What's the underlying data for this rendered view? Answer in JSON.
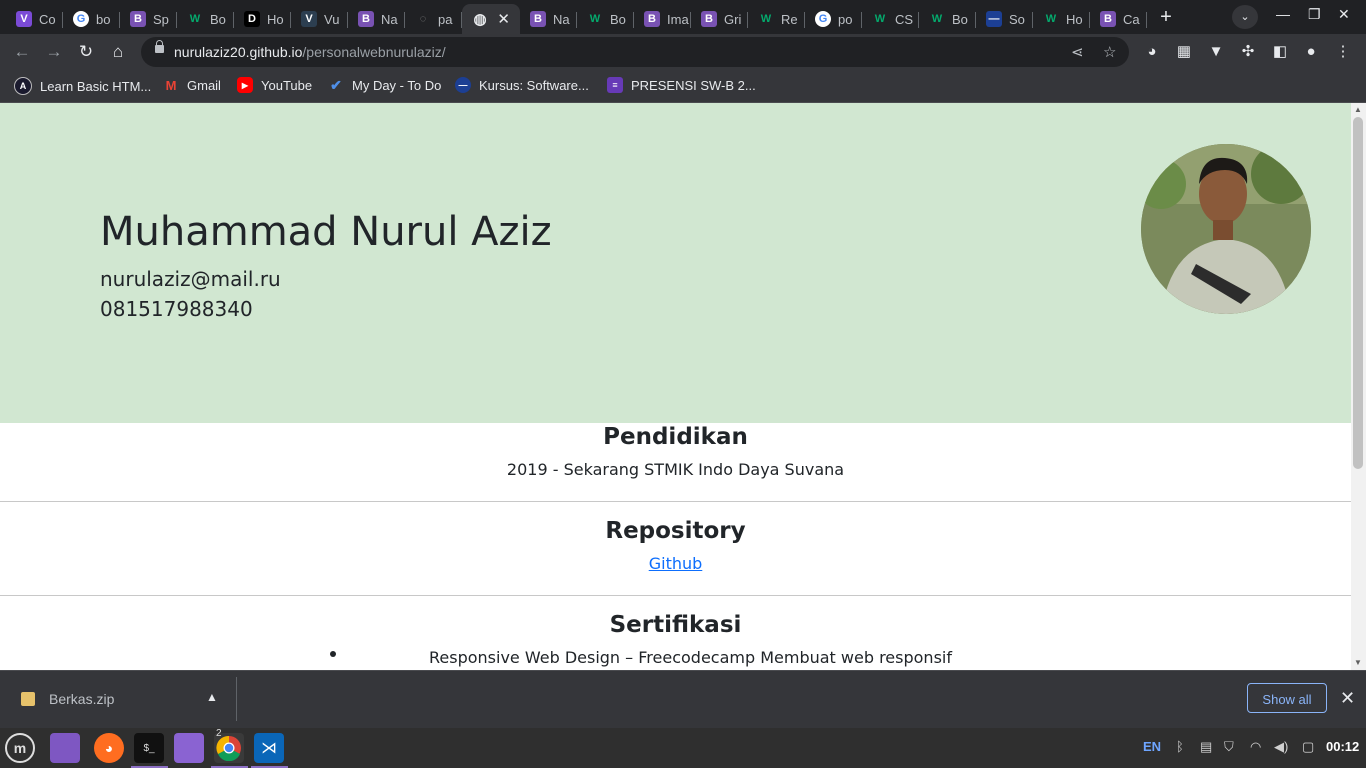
{
  "browser": {
    "tabs": [
      {
        "label": "Co",
        "icon": "vue-icon",
        "color": "#7b4bd6"
      },
      {
        "label": "bo",
        "icon": "google-icon",
        "color": "#ffffff"
      },
      {
        "label": "Sp",
        "icon": "bootstrap-icon",
        "color": "#7952b3"
      },
      {
        "label": "Bo",
        "icon": "w3schools-icon",
        "color": "#04aa6d"
      },
      {
        "label": "Ho",
        "icon": "dev-icon",
        "color": "#000000"
      },
      {
        "label": "Vu",
        "icon": "vue-icon",
        "color": "#2c3e50"
      },
      {
        "label": "Na",
        "icon": "bootstrap-icon",
        "color": "#7952b3"
      },
      {
        "label": "pa",
        "icon": "loading-icon",
        "color": "#555555"
      },
      {
        "label": "",
        "icon": "globe-icon",
        "color": "#e8eaed",
        "active": true
      },
      {
        "label": "Na",
        "icon": "bootstrap-icon",
        "color": "#7952b3"
      },
      {
        "label": "Bo",
        "icon": "w3schools-icon",
        "color": "#04aa6d"
      },
      {
        "label": "Ima",
        "icon": "bootstrap-icon",
        "color": "#7952b3"
      },
      {
        "label": "Gri",
        "icon": "bootstrap-icon",
        "color": "#7952b3"
      },
      {
        "label": "Re",
        "icon": "w3schools-icon",
        "color": "#04aa6d"
      },
      {
        "label": "po",
        "icon": "google-icon",
        "color": "#ffffff"
      },
      {
        "label": "CS",
        "icon": "w3schools-icon",
        "color": "#04aa6d"
      },
      {
        "label": "Bo",
        "icon": "w3schools-icon",
        "color": "#04aa6d"
      },
      {
        "label": "So",
        "icon": "kursus-icon",
        "color": "#1c3f94"
      },
      {
        "label": "Ho",
        "icon": "w3schools-icon",
        "color": "#04aa6d"
      },
      {
        "label": "Ca",
        "icon": "bootstrap-icon",
        "color": "#7952b3"
      }
    ],
    "url_host": "nurulaziz20.github.io",
    "url_path": "/personalwebnurulaziz/",
    "bookmarks": [
      {
        "label": "Learn Basic HTM...",
        "icon": "learn-icon",
        "color": "#1a1a2e"
      },
      {
        "label": "Gmail",
        "icon": "gmail-icon",
        "color": "#ea4335"
      },
      {
        "label": "YouTube",
        "icon": "youtube-icon",
        "color": "#ff0000"
      },
      {
        "label": "My Day - To Do",
        "icon": "todo-icon",
        "color": "#2564cf"
      },
      {
        "label": "Kursus: Software...",
        "icon": "kursus-icon",
        "color": "#1c3f94"
      },
      {
        "label": "PRESENSI SW-B 2...",
        "icon": "forms-icon",
        "color": "#673ab7"
      }
    ]
  },
  "profile": {
    "name": "Muhammad Nurul Aziz",
    "email": "nurulaziz@mail.ru",
    "phone": "081517988340",
    "hero_color": "#d1e7d1"
  },
  "sections": {
    "education_title": "Pendidikan",
    "education_text": "2019 - Sekarang STMIK Indo Daya Suvana",
    "repo_title": "Repository",
    "repo_link": "Github",
    "cert_title": "Sertifikasi",
    "cert_item": "Responsive Web Design – Freecodecamp Membuat web responsif"
  },
  "download": {
    "filename": "Berkas.zip",
    "show_all": "Show all"
  },
  "taskbar": {
    "lang": "EN",
    "clock": "00:12",
    "chrome_badge": "2"
  }
}
